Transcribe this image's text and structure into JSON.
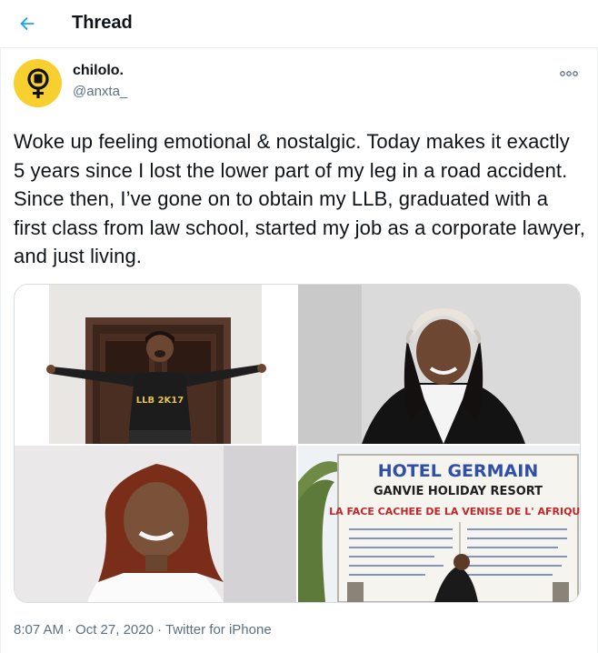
{
  "header": {
    "title": "Thread",
    "back_icon": "arrow-left-icon"
  },
  "tweet": {
    "user_name": "chilolo.",
    "user_handle": "@anxta_",
    "avatar_icon": "raised-fist-venus-icon",
    "more_icon": "more-options-icon",
    "text": "Woke up feeling emotional & nostalgic. Today makes it exactly 5 years since I lost the lower part of my leg in a road accident. Since then, I’ve gone on to obtain my LLB, graduated with a first class from law school, started my job as a corporate lawyer, and just living.",
    "photos": [
      {
        "sweater_text": "LLB 2K17"
      },
      {},
      {},
      {
        "sign_line1": "HOTEL GERMAIN",
        "sign_line2": "GANVIE HOLIDAY RESORT",
        "sign_line3": "LA FACE CACHEE DE LA VENISE DE L' AFRIQUE"
      }
    ],
    "time": "8:07 AM",
    "date": "Oct 27, 2020",
    "source": "Twitter for iPhone",
    "separator": "·"
  },
  "colors": {
    "accent": "#1da1f2",
    "avatar_bg": "#f7d02f",
    "secondary_text": "#5b7083"
  }
}
